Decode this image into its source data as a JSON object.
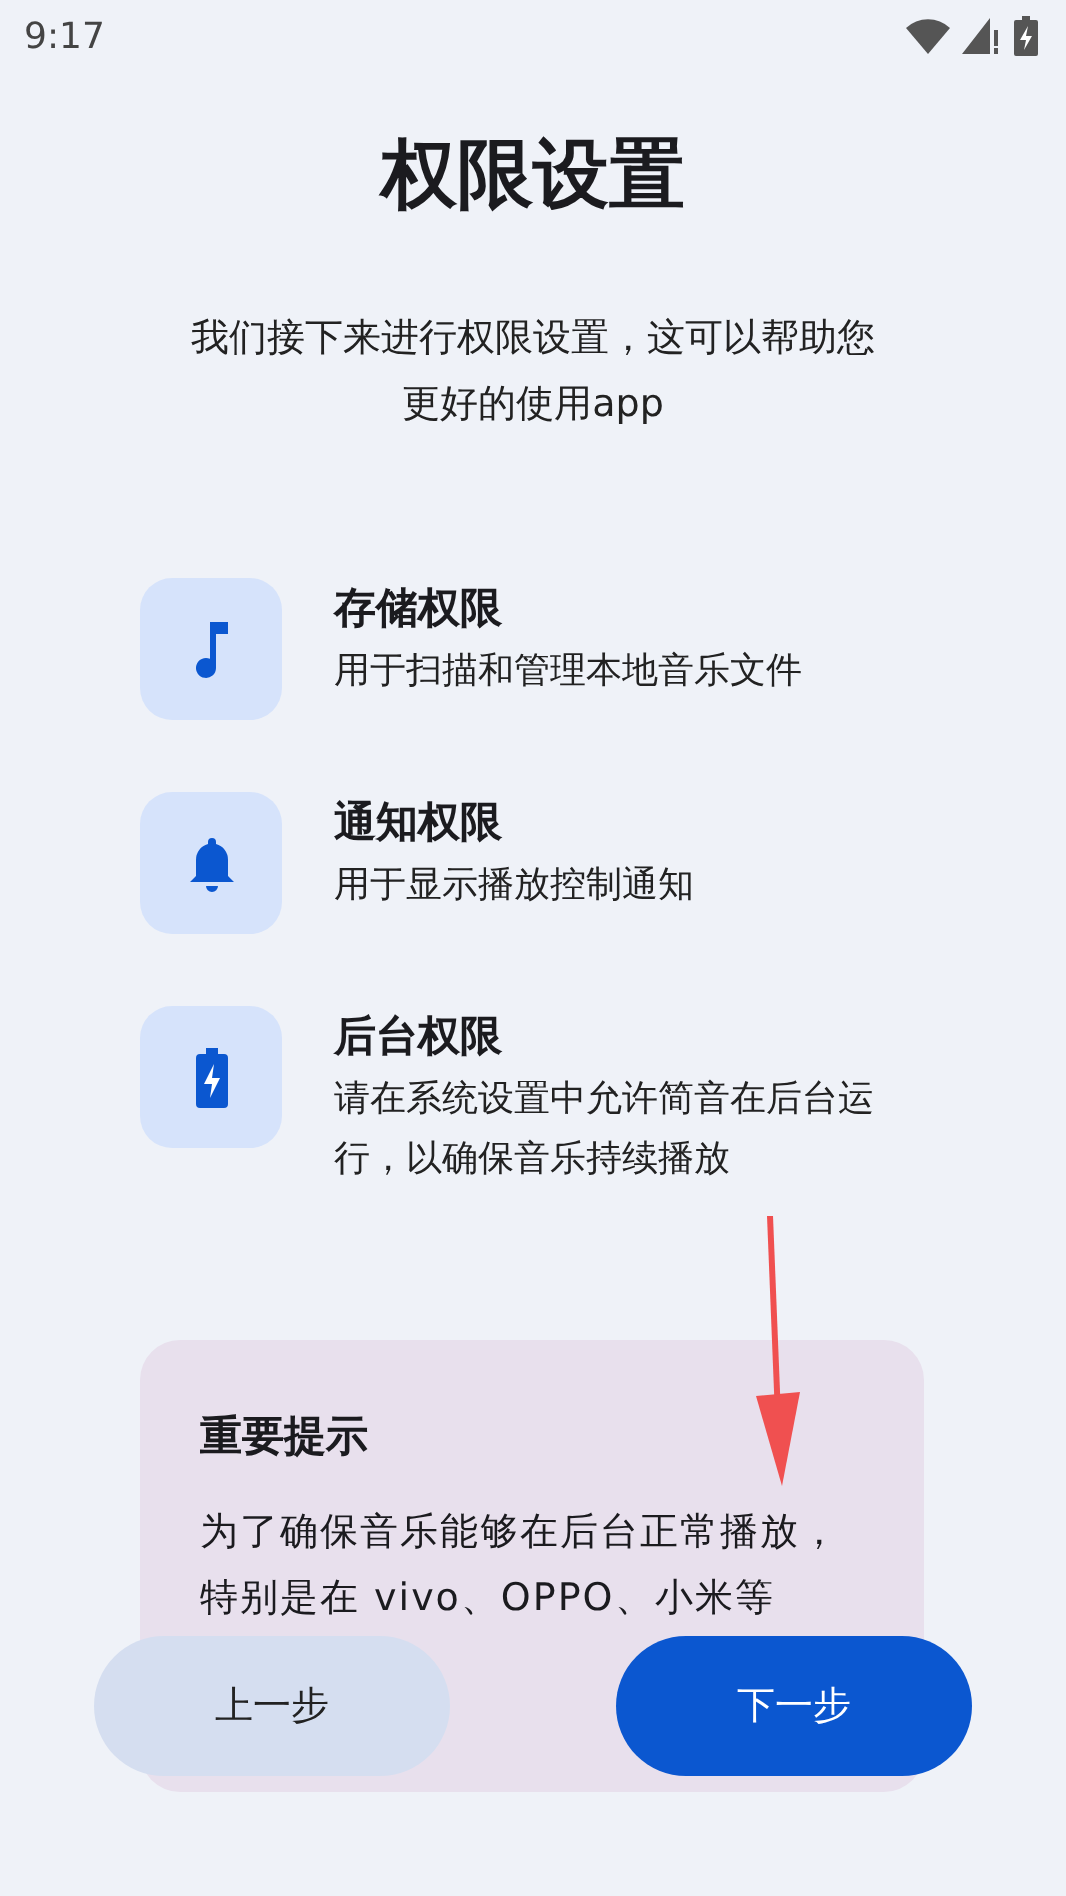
{
  "status_bar": {
    "time": "9:17"
  },
  "title": "权限设置",
  "subtitle": "我们接下来进行权限设置，这可以帮助您更好的使用app",
  "permissions": [
    {
      "kind": "storage",
      "name": "存储权限",
      "description": "用于扫描和管理本地音乐文件"
    },
    {
      "kind": "notification",
      "name": "通知权限",
      "description": "用于显示播放控制通知"
    },
    {
      "kind": "background",
      "name": "后台权限",
      "description": "请在系统设置中允许简音在后台运行，以确保音乐持续播放"
    }
  ],
  "notice": {
    "title": "重要提示",
    "text": "为了确保音乐能够在后台正常播放，特别是在 vivo、OPPO、小米等"
  },
  "buttons": [
    {
      "kind": "secondary",
      "label": "上一步"
    },
    {
      "kind": "primary",
      "label": "下一步"
    }
  ]
}
